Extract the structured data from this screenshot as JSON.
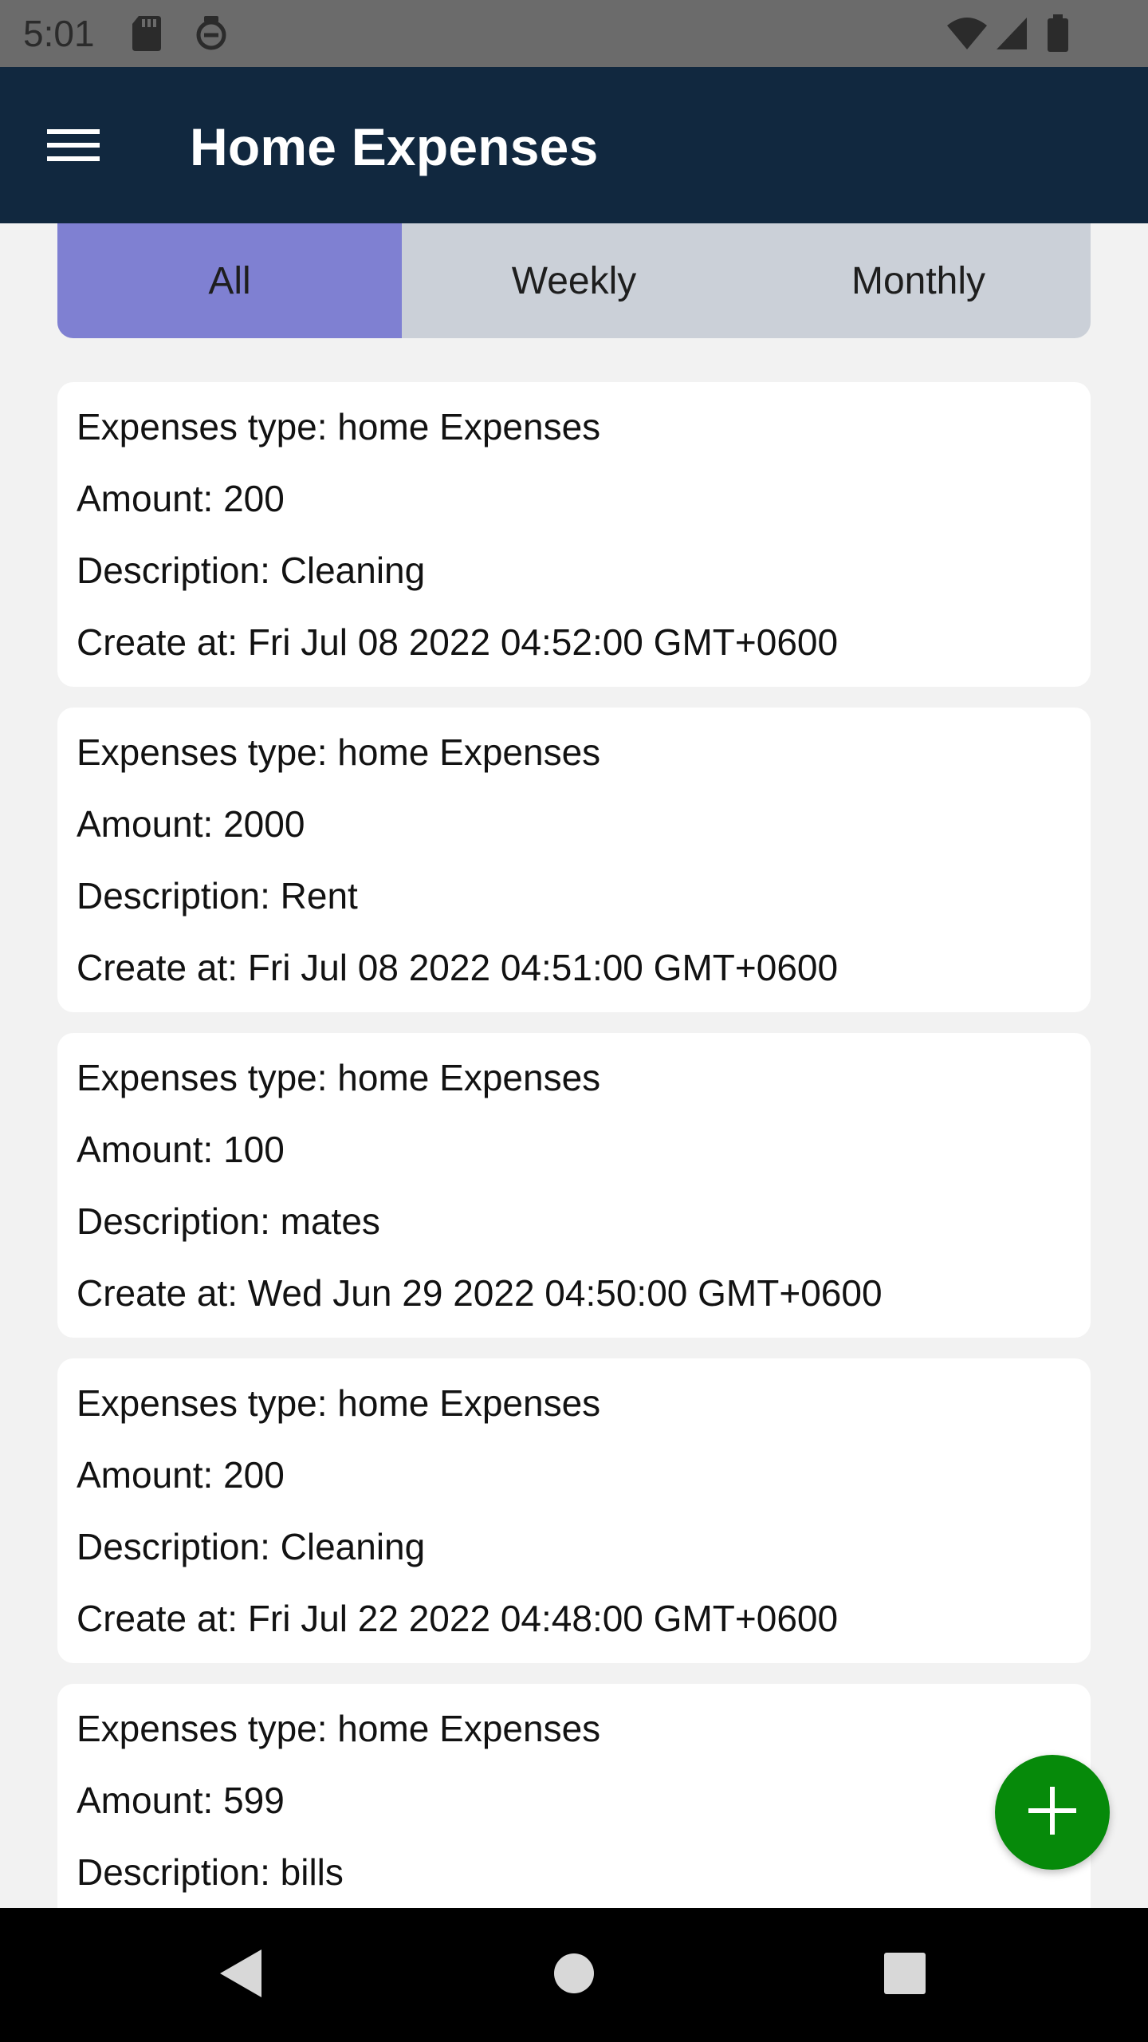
{
  "status_bar": {
    "time": "5:01",
    "left_icons": [
      "sd-card-icon",
      "shield-icon"
    ],
    "right_icons": [
      "wifi-icon",
      "signal-icon",
      "battery-icon"
    ]
  },
  "app_bar": {
    "title": "Home Expenses",
    "menu_icon": "hamburger-menu-icon",
    "background_color": "#11283f"
  },
  "tabs": [
    {
      "label": "All",
      "active": true
    },
    {
      "label": "Weekly",
      "active": false
    },
    {
      "label": "Monthly",
      "active": false
    }
  ],
  "colors": {
    "active_tab": "#7f80d2",
    "inactive_tab": "#cbd0d8",
    "fab": "#068a0a"
  },
  "expenses": [
    {
      "type": "Expenses type: home Expenses",
      "amount": "Amount: 200",
      "description": "Description: Cleaning",
      "created": "Create at: Fri Jul 08 2022 04:52:00 GMT+0600"
    },
    {
      "type": "Expenses type: home Expenses",
      "amount": "Amount: 2000",
      "description": "Description: Rent",
      "created": "Create at: Fri Jul 08 2022 04:51:00 GMT+0600"
    },
    {
      "type": "Expenses type: home Expenses",
      "amount": "Amount: 100",
      "description": "Description: mates",
      "created": "Create at: Wed Jun 29 2022 04:50:00 GMT+0600"
    },
    {
      "type": "Expenses type: home Expenses",
      "amount": "Amount: 200",
      "description": "Description: Cleaning",
      "created": "Create at: Fri Jul 22 2022 04:48:00 GMT+0600"
    },
    {
      "type": "Expenses type: home Expenses",
      "amount": "Amount: 599",
      "description": "Description: bills",
      "created": ""
    }
  ],
  "fab": {
    "icon": "plus-icon"
  },
  "nav_bar": {
    "icons": [
      "back-icon",
      "home-icon",
      "recents-icon"
    ]
  }
}
